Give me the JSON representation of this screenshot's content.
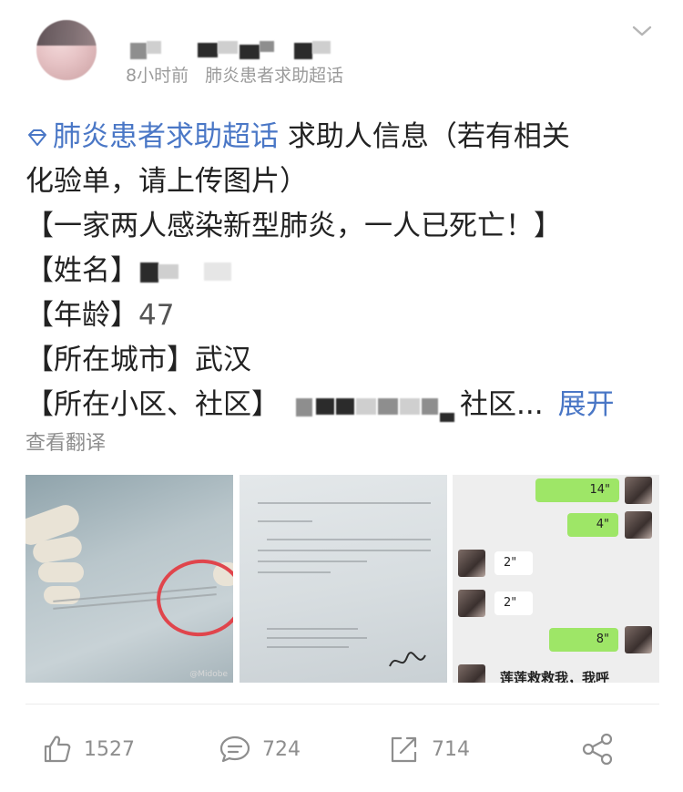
{
  "header": {
    "time": "8小时前",
    "source": "肺炎患者求助超话",
    "menu_icon": "chevron-down-icon"
  },
  "post": {
    "topic": "肺炎患者求助超话",
    "topic_icon": "supertopic-diamond-icon",
    "line1_text": "求助人信息（若有相关",
    "line2": "化验单，请上传图片）",
    "line3": "【一家两人感染新型肺炎，一人已死亡！】",
    "line4_label": "【姓名】",
    "line5_label": "【年龄】",
    "line5_value": "47",
    "line6": "【所在城市】武汉",
    "line7_label": "【所在小区、社区】",
    "line7_suffix": "社区...",
    "expand_label": "展开"
  },
  "translate_label": "查看翻译",
  "images": {
    "img1": {
      "watermark": "@Midobe"
    },
    "img3": {
      "bubbles": [
        "14\"",
        "4\"",
        "2\"",
        "2\"",
        "8\""
      ],
      "last_message": "莲莲救救我，我呼"
    }
  },
  "actions": {
    "like_count": "1527",
    "comment_count": "724",
    "repost_count": "714"
  },
  "colors": {
    "link": "#4a77c6",
    "meta": "#9b9b9b",
    "text": "#222222"
  }
}
